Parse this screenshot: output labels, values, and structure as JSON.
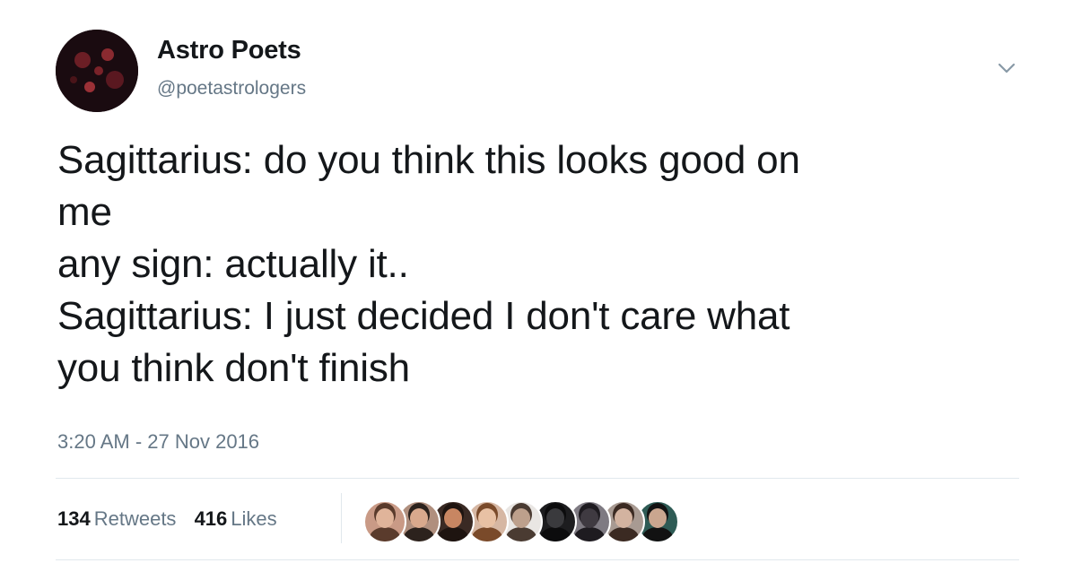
{
  "tweet": {
    "author": {
      "display_name": "Astro Poets",
      "handle": "@poetastrologers"
    },
    "text_lines": [
      "Sagittarius: do you think this looks good on",
      "me",
      "any sign: actually it..",
      "Sagittarius: I just decided I don't care what",
      "you think don't finish"
    ],
    "timestamp": "3:20 AM - 27 Nov 2016",
    "stats": {
      "retweets_count": "134",
      "retweets_label": "Retweets",
      "likes_count": "416",
      "likes_label": "Likes"
    },
    "caret_icon": "chevron-down-icon",
    "liker_avatars": [
      {
        "bg": "#c99a86",
        "skin": "#e0b49a",
        "hair": "#5a3b2c"
      },
      {
        "bg": "#b08f7e",
        "skin": "#d9a98d",
        "hair": "#2c221d"
      },
      {
        "bg": "#3a2a24",
        "skin": "#c88662",
        "hair": "#1e1410"
      },
      {
        "bg": "#d6b7a3",
        "skin": "#e8c1a4",
        "hair": "#7a4a2a"
      },
      {
        "bg": "#e9e6e3",
        "skin": "#bda08c",
        "hair": "#4a3b32"
      },
      {
        "bg": "#1d1d1f",
        "skin": "#3a3a3d",
        "hair": "#0c0c0d"
      },
      {
        "bg": "#7e7a82",
        "skin": "#3f3a41",
        "hair": "#1e1b20"
      },
      {
        "bg": "#a89a92",
        "skin": "#d3b3a0",
        "hair": "#3b2a22"
      },
      {
        "bg": "#2e5b55",
        "skin": "#caa68f",
        "hair": "#121212"
      }
    ]
  }
}
